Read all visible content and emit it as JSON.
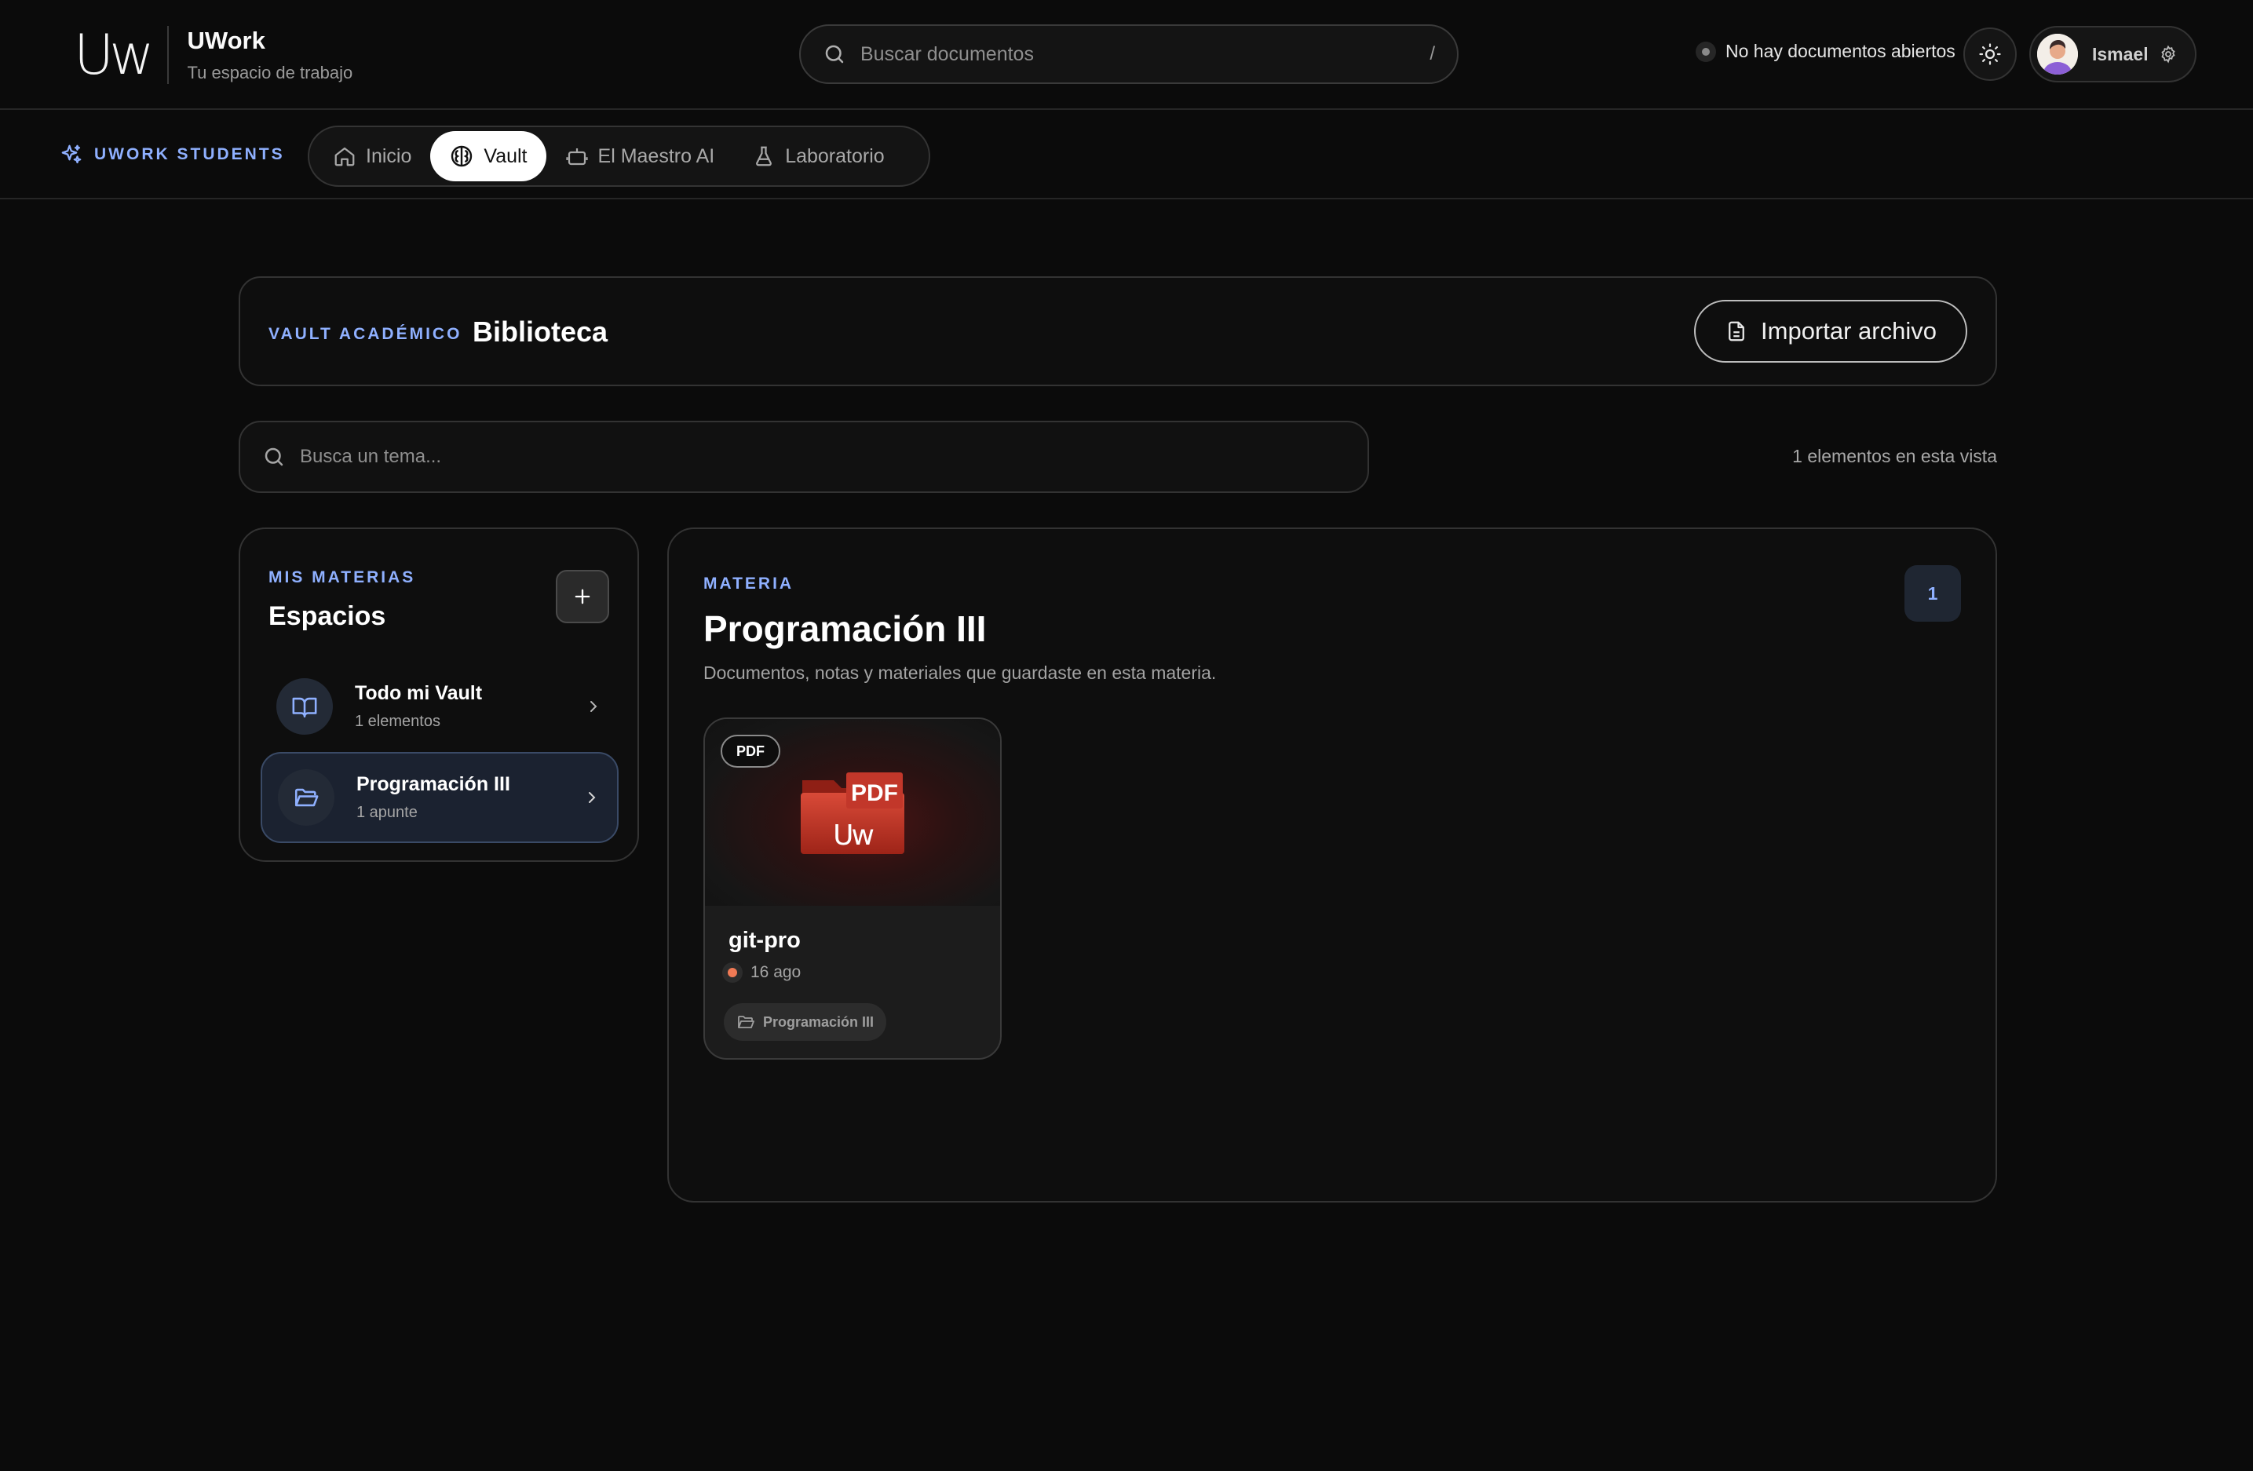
{
  "header": {
    "logo_text": "Uw",
    "app_name": "UWork",
    "tagline": "Tu espacio de trabajo",
    "search_placeholder": "Buscar documentos",
    "search_shortcut": "/",
    "doc_status": "No hay documentos abiertos",
    "user_name": "Ismael"
  },
  "nav": {
    "brand_label": "UWORK STUDENTS",
    "tabs": [
      {
        "label": "Inicio",
        "icon": "home-icon",
        "active": false
      },
      {
        "label": "Vault",
        "icon": "brain-icon",
        "active": true
      },
      {
        "label": "El Maestro AI",
        "icon": "bot-icon",
        "active": false
      },
      {
        "label": "Laboratorio",
        "icon": "flask-icon",
        "active": false
      }
    ]
  },
  "library": {
    "kicker": "VAULT ACADÉMICO",
    "title": "Biblioteca",
    "import_label": "Importar archivo"
  },
  "topic_search": {
    "placeholder": "Busca un tema..."
  },
  "view_count": "1 elementos en esta vista",
  "spaces": {
    "kicker": "MIS MATERIAS",
    "title": "Espacios",
    "items": [
      {
        "name": "Todo mi Vault",
        "meta": "1 elementos",
        "icon": "book-open-icon",
        "active": false
      },
      {
        "name": "Programación III",
        "meta": "1 apunte",
        "icon": "folder-open-icon",
        "active": true
      }
    ]
  },
  "materia": {
    "kicker": "MATERIA",
    "title": "Programación III",
    "description": "Documentos, notas y materiales que guardaste en esta materia.",
    "count": "1",
    "documents": [
      {
        "badge": "PDF",
        "thumb_label": "PDF",
        "thumb_logo": "Uw",
        "name": "git-pro",
        "date": "16 ago",
        "tag": "Programación III"
      }
    ]
  },
  "colors": {
    "background": "#0b0b0b",
    "accent_blue": "#8fb0ff",
    "active_space_bg": "#1b2230",
    "pdf_red": "#c93a2a",
    "date_dot": "#f07a55"
  }
}
